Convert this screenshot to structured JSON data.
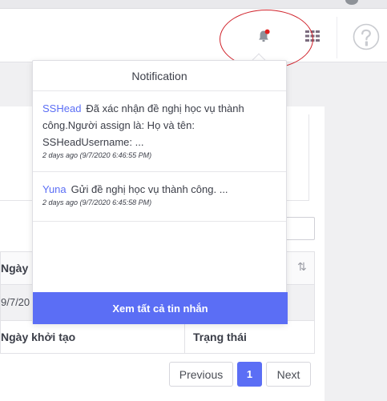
{
  "header": {
    "bell_icon": "bell-icon",
    "apps_icon": "grid-icon",
    "help_icon": "help-icon"
  },
  "notification": {
    "title": "Notification",
    "items": [
      {
        "sender": "SSHead",
        "message": "Đã xác nhận đề nghị học vụ thành công.Người assign là: Họ và tên: SSHeadUsername: ...",
        "time": "2 days ago (9/7/2020 6:46:55 PM)"
      },
      {
        "sender": "Yuna",
        "message": "Gửi đề nghị học vụ thành công. ...",
        "time": "2 days ago (9/7/2020 6:45:58 PM)"
      }
    ],
    "view_all_label": "Xem tất cả tin nhắn"
  },
  "table": {
    "header_col1": "Ngày k",
    "row_col1": "9/7/20",
    "footer_col1": "Ngày khởi tạo",
    "footer_col2": "Trạng thái",
    "sort_icon": "sort-icon"
  },
  "pagination": {
    "previous_label": "Previous",
    "current_page": "1",
    "next_label": "Next"
  },
  "colors": {
    "accent": "#5b6ef5",
    "annotation": "#d0212a",
    "badge": "#e02020"
  }
}
